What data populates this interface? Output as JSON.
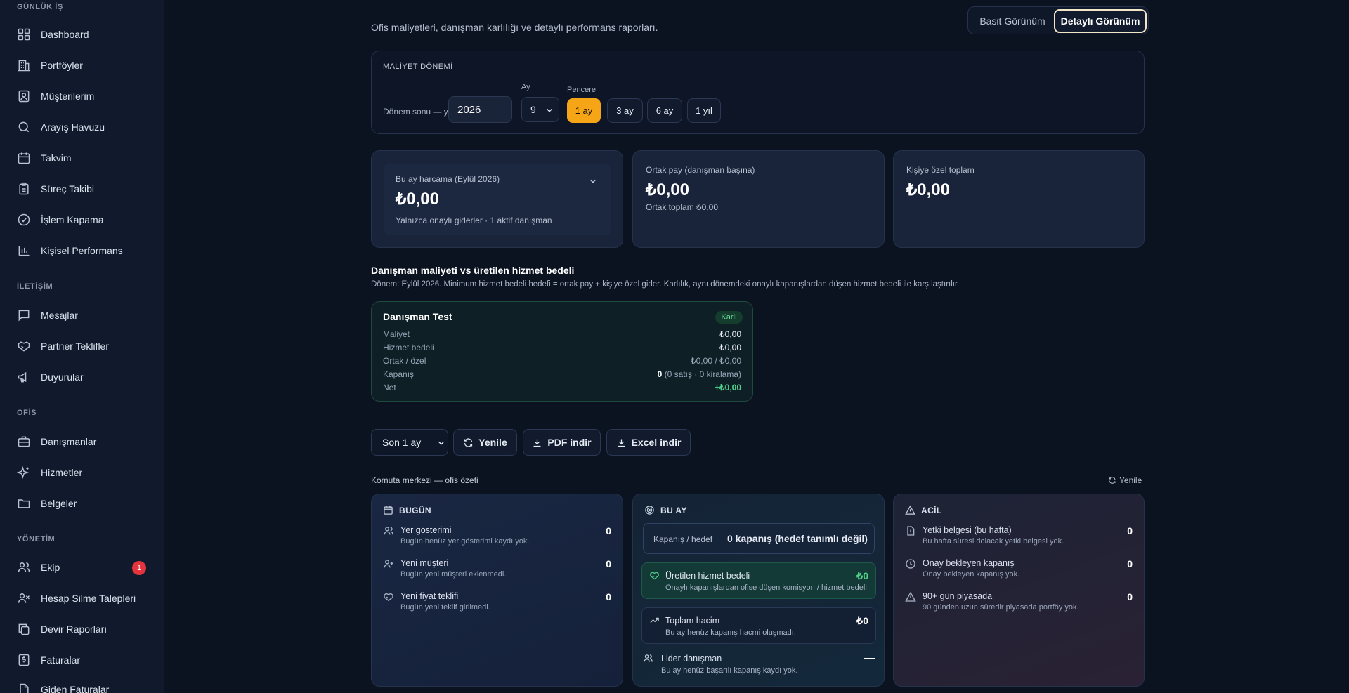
{
  "sidebar": {
    "sections": [
      {
        "label": "GÜNLÜK İŞ",
        "items": [
          {
            "label": "Dashboard",
            "icon": "dashboard-icon"
          },
          {
            "label": "Portföyler",
            "icon": "building-icon"
          },
          {
            "label": "Müşterilerim",
            "icon": "contact-icon"
          },
          {
            "label": "Arayış Havuzu",
            "icon": "search-icon"
          },
          {
            "label": "Takvim",
            "icon": "calendar-icon"
          },
          {
            "label": "Süreç Takibi",
            "icon": "clipboard-icon"
          },
          {
            "label": "İşlem Kapama",
            "icon": "check-circle-icon"
          },
          {
            "label": "Kişisel Performans",
            "icon": "bar-chart-icon"
          }
        ]
      },
      {
        "label": "İLETİŞİM",
        "items": [
          {
            "label": "Mesajlar",
            "icon": "message-icon"
          },
          {
            "label": "Partner Teklifler",
            "icon": "handshake-icon"
          },
          {
            "label": "Duyurular",
            "icon": "megaphone-icon"
          }
        ]
      },
      {
        "label": "OFİS",
        "items": [
          {
            "label": "Danışmanlar",
            "icon": "briefcase-icon"
          },
          {
            "label": "Hizmetler",
            "icon": "sparkles-icon"
          },
          {
            "label": "Belgeler",
            "icon": "folder-icon"
          }
        ]
      },
      {
        "label": "YÖNETİM",
        "items": [
          {
            "label": "Ekip",
            "icon": "users-icon",
            "badge": "1"
          },
          {
            "label": "Hesap Silme Talepleri",
            "icon": "user-x-icon"
          },
          {
            "label": "Devir Raporları",
            "icon": "copy-icon"
          },
          {
            "label": "Faturalar",
            "icon": "invoice-icon"
          },
          {
            "label": "Giden Faturalar",
            "icon": "file-icon"
          }
        ]
      }
    ]
  },
  "header": {
    "subtitle": "Ofis maliyetleri, danışman karlılığı ve detaylı performans raporları.",
    "view_simple": "Basit Görünüm",
    "view_detailed": "Detaylı Görünüm",
    "active_view": "Detaylı Görünüm"
  },
  "period": {
    "title": "MALİYET DÖNEMİ",
    "year_label": "Dönem sonu — yıl",
    "year_value": "2026",
    "month_label": "Ay",
    "month_value": "9",
    "window_label": "Pencere",
    "windows": [
      "1 ay",
      "3 ay",
      "6 ay",
      "1 yıl"
    ],
    "active_window": "1 ay"
  },
  "summary": {
    "spend": {
      "title": "Bu ay harcama (Eylül 2026)",
      "value": "₺0,00",
      "note": "Yalnızca onaylı giderler · 1 aktif danışman"
    },
    "shared": {
      "title": "Ortak pay (danışman başına)",
      "value": "₺0,00",
      "note": "Ortak toplam ₺0,00"
    },
    "personal": {
      "title": "Kişiye özel toplam",
      "value": "₺0,00"
    }
  },
  "cost_vs_fee": {
    "title": "Danışman maliyeti vs üretilen hizmet bedeli",
    "description": "Dönem: Eylül 2026. Minimum hizmet bedeli hedefi = ortak pay + kişiye özel gider. Karlılık, aynı dönemdeki onaylı kapanışlardan düşen hizmet bedeli ile karşılaştırılır.",
    "advisor": {
      "name": "Danışman Test",
      "badge": "Karlı",
      "rows": [
        {
          "label": "Maliyet",
          "value": "₺0,00"
        },
        {
          "label": "Hizmet bedeli",
          "value": "₺0,00"
        },
        {
          "label": "Ortak / özel",
          "value": "₺0,00 / ₺0,00"
        },
        {
          "label": "Kapanış",
          "value_bold": "0",
          "value_rest": " (0 satış · 0 kiralama)"
        },
        {
          "label": "Net",
          "value": "+₺0,00"
        }
      ]
    }
  },
  "toolbar": {
    "range_value": "Son 1 ay",
    "refresh": "Yenile",
    "pdf": "PDF indir",
    "excel": "Excel indir"
  },
  "command": {
    "title": "Komuta merkezi — ofis özeti",
    "refresh": "Yenile",
    "today": {
      "title": "BUGÜN",
      "items": [
        {
          "title": "Yer gösterimi",
          "desc": "Bugün henüz yer gösterimi kaydı yok.",
          "value": "0",
          "icon": "users-icon"
        },
        {
          "title": "Yeni müşteri",
          "desc": "Bugün yeni müşteri eklenmedi.",
          "value": "0",
          "icon": "user-plus-icon"
        },
        {
          "title": "Yeni fiyat teklifi",
          "desc": "Bugün yeni teklif girilmedi.",
          "value": "0",
          "icon": "handshake-icon"
        }
      ]
    },
    "month": {
      "title": "BU AY",
      "target_label": "Kapanış / hedef",
      "target_value": "0 kapanış (hedef tanımlı değil)",
      "fee": {
        "title": "Üretilen hizmet bedeli",
        "desc": "Onaylı kapanışlardan ofise düşen komisyon / hizmet bedeli",
        "value": "₺0"
      },
      "volume": {
        "title": "Toplam hacim",
        "desc": "Bu ay henüz kapanış hacmi oluşmadı.",
        "value": "₺0"
      },
      "leader": {
        "title": "Lider danışman",
        "desc": "Bu ay henüz başarılı kapanış kaydı yok.",
        "value": "—"
      }
    },
    "urgent": {
      "title": "ACİL",
      "items": [
        {
          "title": "Yetki belgesi (bu hafta)",
          "desc": "Bu hafta süresi dolacak yetki belgesi yok.",
          "value": "0",
          "icon": "file-warning-icon"
        },
        {
          "title": "Onay bekleyen kapanış",
          "desc": "Onay bekleyen kapanış yok.",
          "value": "0",
          "icon": "clock-icon"
        },
        {
          "title": "90+ gün piyasada",
          "desc": "90 günden uzun süredir piyasada portföy yok.",
          "value": "0",
          "icon": "warning-icon"
        }
      ]
    }
  },
  "colors": {
    "accent": "#f5a516",
    "positive": "#4fd18b",
    "badge_red": "#e5343d",
    "background": "#0b1220",
    "sidebar": "#111a2c"
  }
}
